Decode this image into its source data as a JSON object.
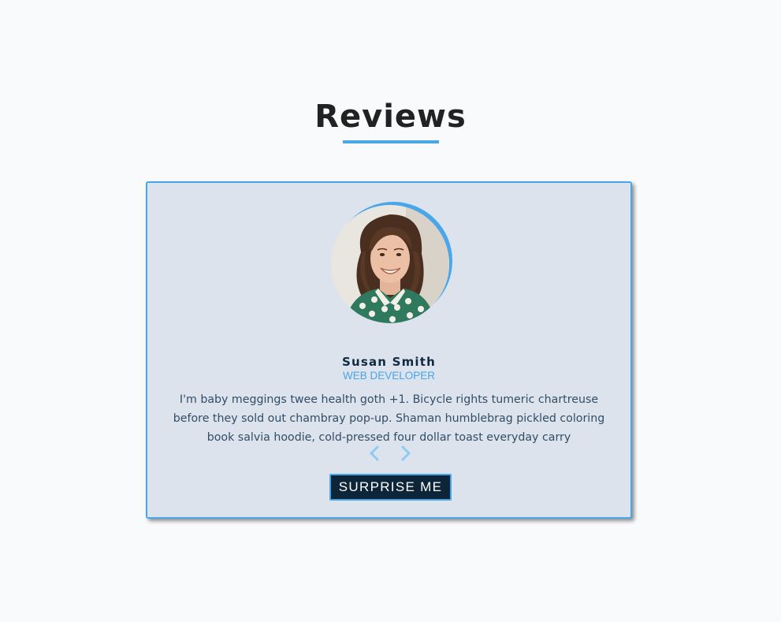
{
  "section": {
    "title": "Reviews"
  },
  "review": {
    "name": "Susan Smith",
    "job": "WEB DEVELOPER",
    "text": "I'm baby meggings twee health goth +1. Bicycle rights tumeric chartreuse before they sold out chambray pop-up. Shaman humblebrag pickled coloring book salvia hoodie, cold-pressed four dollar toast everyday carry"
  },
  "controls": {
    "prev_icon": "chevron-left-icon",
    "next_icon": "chevron-right-icon",
    "surprise_label": "SURPRISE ME"
  },
  "colors": {
    "accent": "#49a6e9",
    "card_bg": "#dce3ec",
    "button_bg": "#0d2538",
    "title": "#222222",
    "name": "#102a42",
    "text": "#324d67",
    "page_bg": "#f8fafc"
  }
}
